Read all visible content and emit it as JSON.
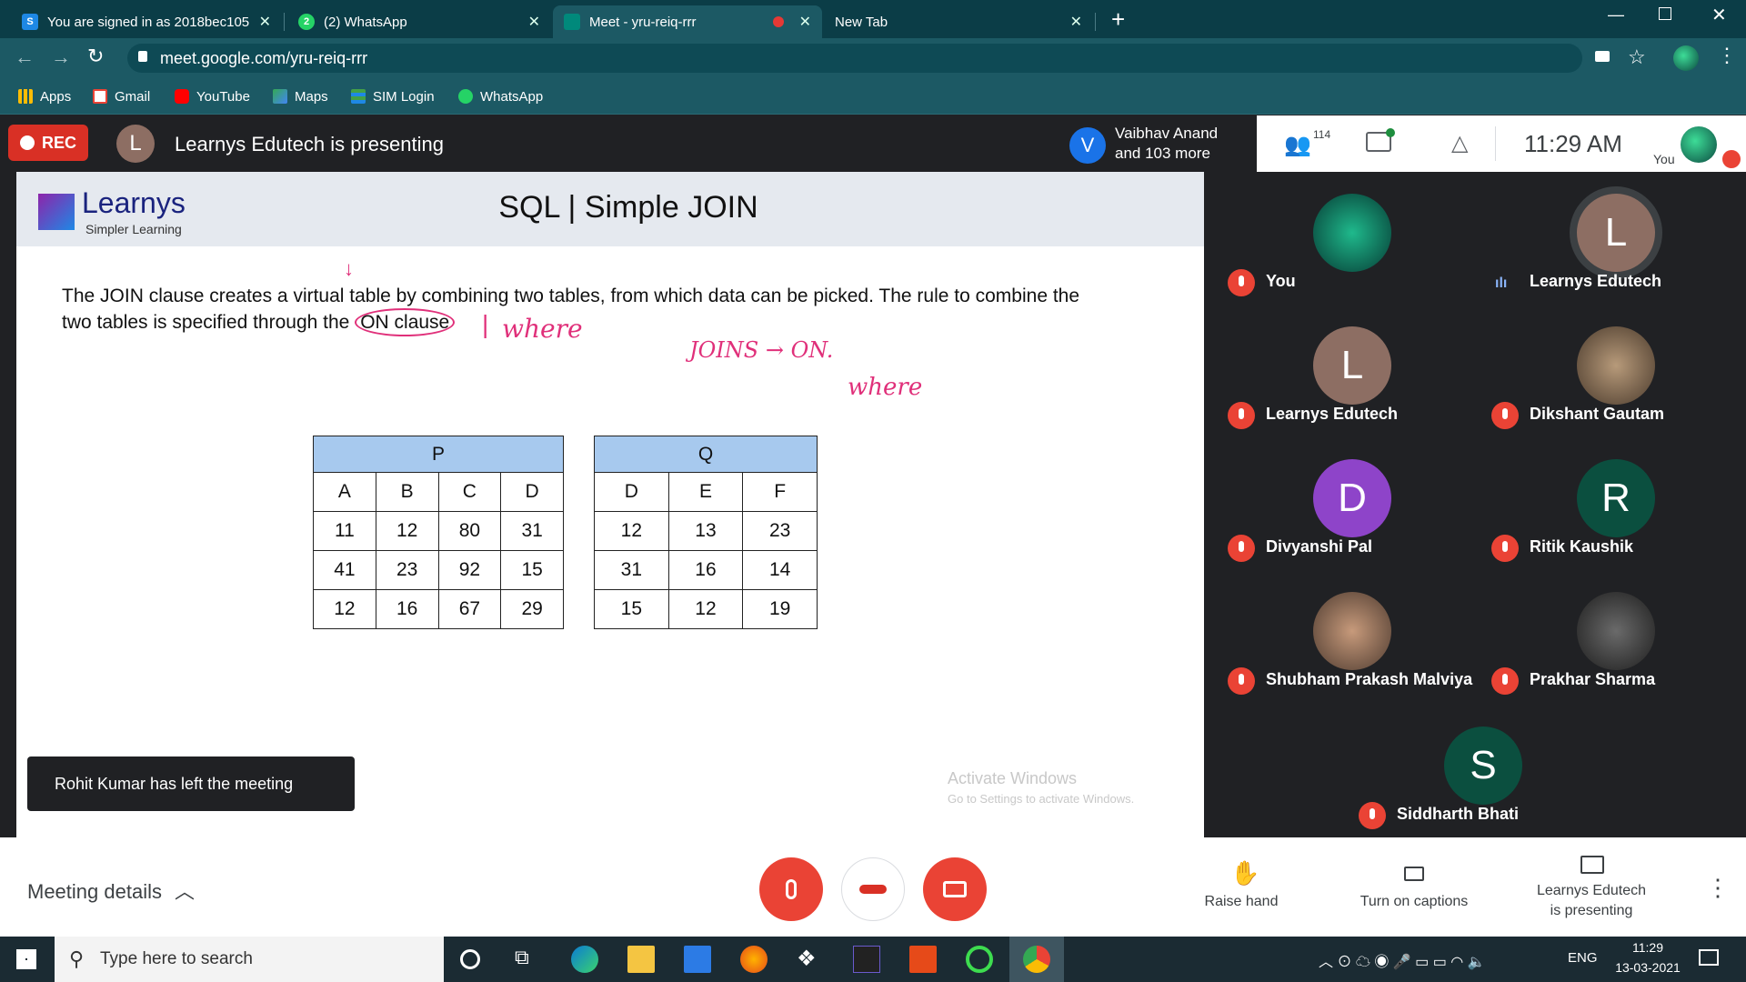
{
  "browser": {
    "tabs": [
      {
        "label": "You are signed in as 2018bec105",
        "icon": "s-icon"
      },
      {
        "label": "(2) WhatsApp",
        "icon": "whatsapp-icon"
      },
      {
        "label": "Meet - yru-reiq-rrr",
        "icon": "meet-icon"
      },
      {
        "label": "New Tab",
        "icon": ""
      }
    ],
    "new_tab": "+",
    "url": "meet.google.com/yru-reiq-rrr",
    "bookmarks": [
      "Apps",
      "Gmail",
      "YouTube",
      "Maps",
      "SIM Login",
      "WhatsApp"
    ]
  },
  "meet": {
    "rec_label": "REC",
    "presenter_initial": "L",
    "presenting_title": "Learnys Edutech is presenting",
    "participant_initial": "V",
    "participants_line1": "Vaibhav Anand",
    "participants_line2": "and 103 more",
    "people_count": "114",
    "time": "11:29 AM",
    "you_label": "You",
    "toast": "Rohit Kumar has left the meeting",
    "meeting_details": "Meeting details",
    "raise_hand": "Raise hand",
    "captions": "Turn on captions",
    "presenting_line1": "Learnys Edutech",
    "presenting_line2": "is presenting",
    "watermark1": "Activate Windows",
    "watermark2": "Go to Settings to activate Windows."
  },
  "slide": {
    "logo": "Learnys",
    "logo_sub": "Simpler Learning",
    "title": "SQL | Simple JOIN",
    "body_line1": "The JOIN clause creates a virtual table by combining two tables, from which data can be picked. The rule to combine the",
    "body_line2_pre": "two tables is specified through the ",
    "body_line2_hl": "ON clause",
    "annotation1": "where",
    "annotation2": "JOINS → ON.",
    "annotation3": "where",
    "table_p": {
      "title": "P",
      "headers": [
        "A",
        "B",
        "C",
        "D"
      ],
      "rows": [
        [
          "11",
          "12",
          "80",
          "31"
        ],
        [
          "41",
          "23",
          "92",
          "15"
        ],
        [
          "12",
          "16",
          "67",
          "29"
        ]
      ]
    },
    "table_q": {
      "title": "Q",
      "headers": [
        "D",
        "E",
        "F"
      ],
      "rows": [
        [
          "12",
          "13",
          "23"
        ],
        [
          "31",
          "16",
          "14"
        ],
        [
          "15",
          "12",
          "19"
        ]
      ]
    }
  },
  "participants": [
    {
      "name": "You",
      "initial": "",
      "color": "#0d6b5a",
      "mic": "muted"
    },
    {
      "name": "Learnys Edutech",
      "initial": "L",
      "color": "#8d6e63",
      "mic": "speaking"
    },
    {
      "name": "Learnys Edutech",
      "initial": "L",
      "color": "#8d6e63",
      "mic": "muted"
    },
    {
      "name": "Dikshant Gautam",
      "initial": "",
      "color": "#6d5c48",
      "mic": "muted"
    },
    {
      "name": "Divyanshi Pal",
      "initial": "D",
      "color": "#8e44c9",
      "mic": "muted"
    },
    {
      "name": "Ritik Kaushik",
      "initial": "R",
      "color": "#0b4f3f",
      "mic": "muted"
    },
    {
      "name": "Shubham Prakash Malviya",
      "initial": "",
      "color": "#7a5b4a",
      "mic": "muted"
    },
    {
      "name": "Prakhar Sharma",
      "initial": "",
      "color": "#3a3a3a",
      "mic": "muted"
    },
    {
      "name": "Siddharth Bhati",
      "initial": "S",
      "color": "#0b4f3f",
      "mic": "muted"
    }
  ],
  "taskbar": {
    "search_placeholder": "Type here to search",
    "lang": "ENG",
    "clock_time": "11:29",
    "clock_date": "13-03-2021"
  }
}
